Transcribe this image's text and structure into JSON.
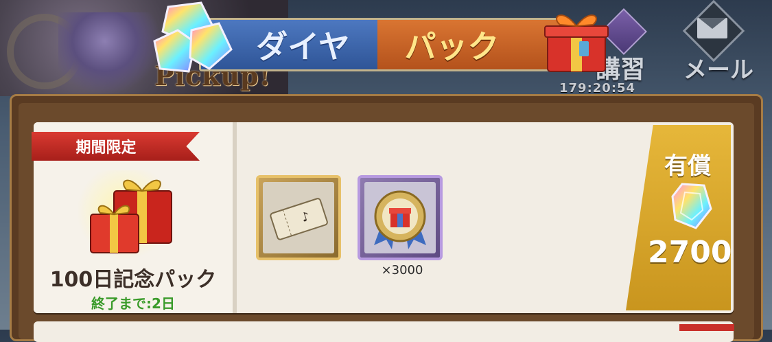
{
  "header": {
    "tabs": [
      {
        "label": "ダイヤ",
        "active": false
      },
      {
        "label": "パック",
        "active": true
      }
    ],
    "banner_text": "Pickup!",
    "lecture": {
      "label": "講習",
      "timer": "179:20:54"
    },
    "mail": {
      "label": "メール"
    }
  },
  "pack": {
    "badge": "期間限定",
    "name": "100日記念パック",
    "remaining": "終了まで:2日",
    "items": [
      {
        "icon": "ticket-icon",
        "quantity": ""
      },
      {
        "icon": "gift-medal-icon",
        "quantity": "×3000"
      }
    ],
    "price": {
      "label": "有償",
      "currency_icon": "rainbow-gem-icon",
      "value": "2700"
    }
  },
  "colors": {
    "tab_diamond": "#2f5597",
    "tab_pack": "#b4521c",
    "badge": "#d93a31",
    "remaining": "#3a9b2a",
    "price_bg": "#e6b73a"
  }
}
